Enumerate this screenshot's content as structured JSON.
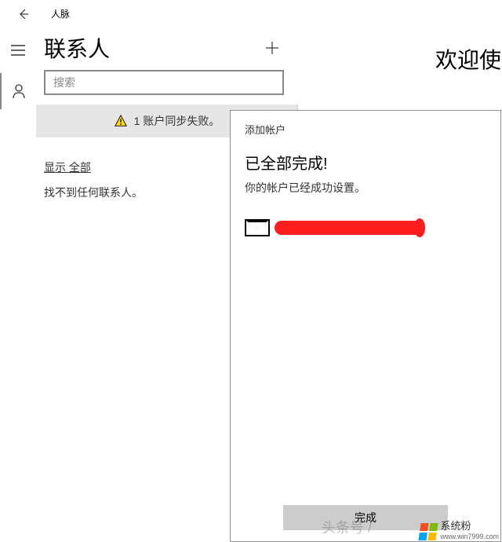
{
  "app": {
    "title": "人脉"
  },
  "contacts": {
    "heading": "联系人",
    "search_placeholder": "搜索",
    "sync_error": "1 账户同步失败。",
    "filter_label": "显示 全部",
    "empty_message": "找不到任何联系人。"
  },
  "right": {
    "welcome": "欢迎使"
  },
  "dialog": {
    "title": "添加帐户",
    "heading": "已全部完成!",
    "subtitle": "你的帐户已经成功设置。",
    "done_label": "完成"
  },
  "watermark": {
    "source": "头条号 /",
    "brand": "系统粉",
    "url": "www.win7999.com"
  }
}
